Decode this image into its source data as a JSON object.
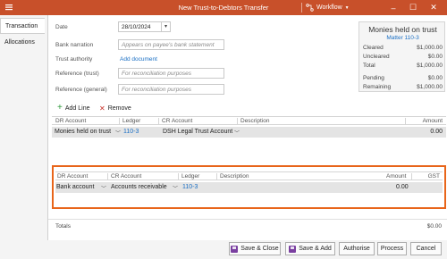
{
  "window": {
    "title": "New Trust-to-Debtors Transfer",
    "workflow_label": "Workflow"
  },
  "tabs": [
    {
      "label": "Transaction"
    },
    {
      "label": "Allocations"
    }
  ],
  "form": {
    "date_label": "Date",
    "date_value": "28/10/2024",
    "bank_narration_label": "Bank narration",
    "bank_narration_placeholder": "Appears on payee's bank statement",
    "trust_authority_label": "Trust authority",
    "add_document_label": "Add document",
    "ref_trust_label": "Reference (trust)",
    "ref_trust_placeholder": "For reconciliation purposes",
    "ref_general_label": "Reference (general)",
    "ref_general_placeholder": "For reconciliation purposes"
  },
  "monies": {
    "title": "Monies held on trust",
    "matter": "Matter 110-3",
    "rows": [
      {
        "label": "Cleared",
        "value": "$1,000.00"
      },
      {
        "label": "Uncleared",
        "value": "$0.00"
      },
      {
        "label": "Total",
        "value": "$1,000.00"
      },
      {
        "label": "Pending",
        "value": "$0.00"
      },
      {
        "label": "Remaining",
        "value": "$1,000.00"
      }
    ]
  },
  "toolbar": {
    "add_line": "Add Line",
    "remove": "Remove"
  },
  "grid1": {
    "headers": {
      "dr": "DR Account",
      "ledger": "Ledger",
      "cr": "CR Account",
      "desc": "Description",
      "amount": "Amount"
    },
    "row": {
      "dr": "Monies held on trust",
      "ledger": "110-3",
      "cr": "DSH Legal Trust Account",
      "amount": "0.00"
    }
  },
  "grid2": {
    "headers": {
      "dr": "DR Account",
      "cr": "CR Account",
      "ledger": "Ledger",
      "desc": "Description",
      "amount": "Amount",
      "gst": "GST"
    },
    "row": {
      "dr": "Bank account",
      "cr": "Accounts receivable",
      "ledger": "110-3",
      "amount": "0.00"
    }
  },
  "totals": {
    "label": "Totals",
    "value": "$0.00"
  },
  "buttons": {
    "save_close": "Save & Close",
    "save_add": "Save & Add",
    "authorise": "Authorise",
    "process": "Process",
    "cancel": "Cancel"
  },
  "colors": {
    "titlebar": "#c8502a",
    "highlight": "#e8651a",
    "link": "#1a6fc4"
  }
}
